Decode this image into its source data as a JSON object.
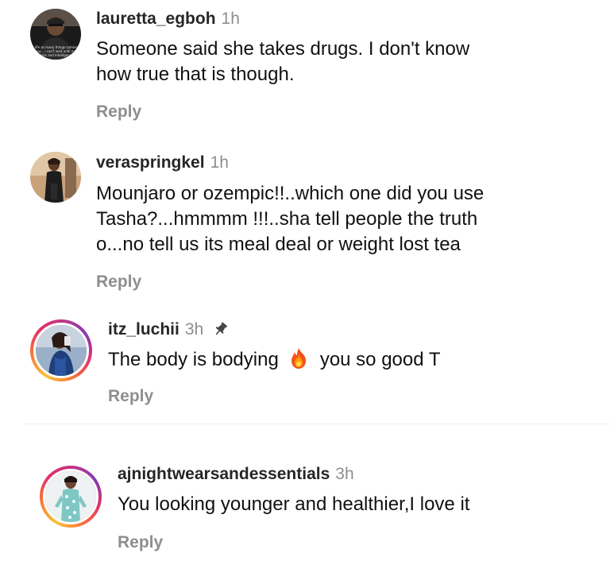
{
  "comments": [
    {
      "username": "lauretta_egboh",
      "time": "1h",
      "text_line1": "Someone said she takes drugs. I don't know",
      "text_line2": "how true that is though.",
      "reply_label": "Reply",
      "avatar_icon": "profile-photo-man-with-caption"
    },
    {
      "username": "veraspringkel",
      "time": "1h",
      "text_line1": "Mounjaro or ozempic!!..which one did you use",
      "text_line2": "Tasha?...hmmmm !!!..sha tell people the truth",
      "text_line3": "o...no tell us its meal deal or weight lost tea",
      "reply_label": "Reply",
      "avatar_icon": "profile-photo-woman-dark-outfit"
    },
    {
      "username": "itz_luchii",
      "time": "3h",
      "pinned_icon": "pin-icon",
      "text_before": "The body is bodying",
      "emoji_icon": "fire-emoji-icon",
      "text_after": "you so good T",
      "reply_label": "Reply",
      "avatar_icon": "profile-photo-woman-selfie-blue-dress"
    },
    {
      "username": "ajnightwearsandessentials",
      "time": "3h",
      "text_line1": "You looking younger and healthier,I love it",
      "reply_label": "Reply",
      "avatar_icon": "profile-photo-woman-teal-pajamas"
    }
  ],
  "colors": {
    "username": "#262626",
    "secondary_text": "#8e8e8e",
    "story_ring_gradient": [
      "#f9c33a",
      "#f77737",
      "#e1306c",
      "#c13584",
      "#833ab4"
    ]
  }
}
